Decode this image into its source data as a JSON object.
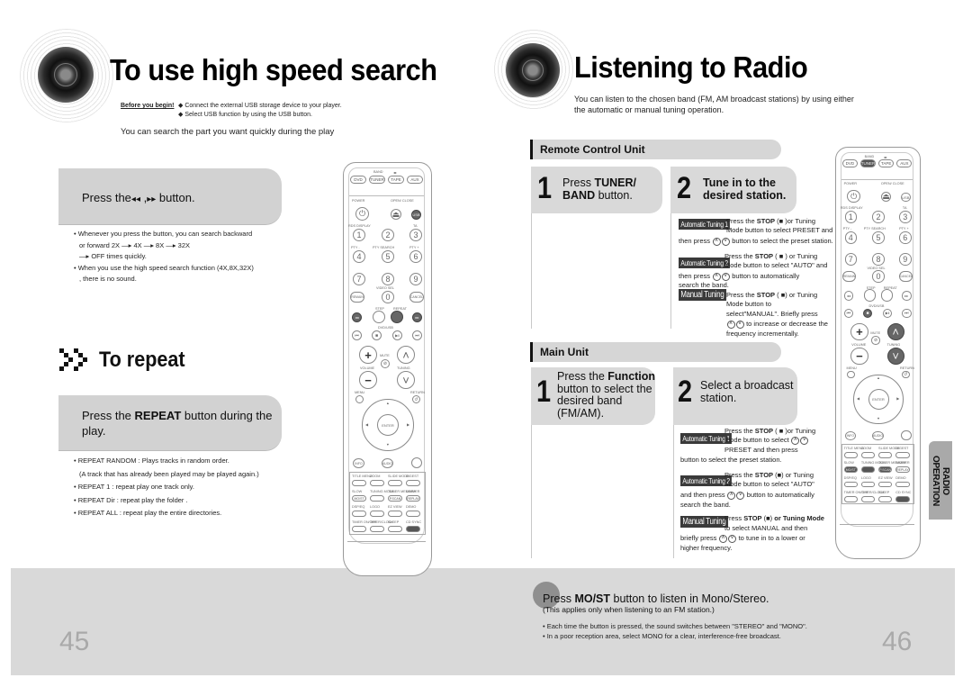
{
  "left_page": {
    "title": "To use high speed search",
    "before_begin_label": "Before you begin!",
    "before_begin_items": [
      "◆ Connect the external USB storage device to your player.",
      "◆ Select USB function by using the USB button."
    ],
    "intro": "You can search the part you want quickly during the play",
    "search_box": {
      "prefix": "Press the",
      "rewind_icon": "◂◂",
      "separator": " ,",
      "ff_icon": "▸▸",
      "suffix": " button."
    },
    "search_bullets": [
      "• Whenever you press  the button, you can search backward",
      "or forward 2X —▸ 4X —▸ 8X —▸ 32X",
      "—▸ OFF times quickly.",
      "• When you use the high speed search function (4X,8X,32X)",
      ", there is no sound."
    ],
    "repeat_title": "To repeat",
    "repeat_box": {
      "prefix": "Press the ",
      "bold": "REPEAT",
      "suffix": " button during the",
      "line2": "play."
    },
    "repeat_bullets": [
      "• REPEAT RANDOM : Plays tracks in random order.",
      "(A track that has already been played may be played again.)",
      "• REPEAT 1 : repeat play one track only.",
      "• REPEAT Dir : repeat play the folder .",
      "• REPEAT ALL : repeat play the entire directories."
    ],
    "page_number": "45"
  },
  "remote": {
    "band_label": "BAND",
    "sources": [
      "DVD",
      "TUNER",
      "TAPE",
      "AUX"
    ],
    "power_label": "POWER",
    "open_close_label": "OPEN/ CLOSE",
    "usb_label": "USB",
    "rds_label": "RDS DISPLAY",
    "ta_label": "TA",
    "pty_minus": "PTY -",
    "pty_search": "PTY SEARCH",
    "pty_plus": "PTY +",
    "digits": [
      "1",
      "2",
      "3",
      "4",
      "5",
      "6",
      "7",
      "8",
      "9",
      "0"
    ],
    "video_sel": "VIDEO SEL",
    "remain": "REMAIN",
    "cancel": "CANCEL",
    "step": "STEP",
    "repeat": "REPEAT",
    "dvd_usb": "DVD/USB",
    "mute": "MUTE",
    "volume": "VOLUME",
    "tuning": "TUNING",
    "menu": "MENU",
    "return": "RETURN",
    "enter": "ENTER",
    "info": "INFO",
    "audio": "AUDIO",
    "func_buttons": [
      [
        "TITLE MENU",
        "ZOOM",
        "SLIDE MODE",
        "DIGEST"
      ],
      [
        "SLOW",
        "TUNING MODE",
        "TUNER MEMORY",
        "DIMMER"
      ],
      [
        "DSP/EQ",
        "LOGO",
        "EZ VIEW",
        "DEMO"
      ],
      [
        "TIMER ON/OFF",
        "TIMER/CLOCK",
        "SLEEP",
        "CD SYNC"
      ]
    ],
    "func_sub": [
      "MO/ST",
      "",
      "P.SCAN",
      "REPLAY"
    ]
  },
  "right_page": {
    "title": "Listening to Radio",
    "intro_line1": "You can listen to the chosen band (FM, AM broadcast stations) by using either",
    "intro_line2": "the automatic or manual tuning operation.",
    "remote_section": {
      "header": "Remote Control Unit",
      "step1": {
        "num": "1",
        "line1_pre": "Press ",
        "line1_bold": "TUNER/",
        "line2_bold": "BAND",
        "line2_post": " button."
      },
      "step2": {
        "num": "2",
        "line1": "Tune in to the",
        "line2": "desired station."
      },
      "tunings": [
        {
          "tag": "Automatic Tuning 1",
          "lines": [
            "Press the STOP (■ )or Tuning",
            "Mode button to select PRESET and",
            "then press  ⌃⌄  button to select the preset station."
          ]
        },
        {
          "tag": "Automatic Tuning 2",
          "lines": [
            "Press the STOP ( ■ ) or Tuning",
            "Mode button to select \"AUTO\" and",
            "then press   ⌃⌄   button to automatically",
            "search the band."
          ]
        },
        {
          "tag": "Manual Tuning",
          "lines": [
            "Press the STOP ( ■) or Tuning",
            "Mode button to",
            "select\"MANUAL\". Briefly press",
            "⌃⌄ to increase or decrease the",
            "frequency incrementally."
          ]
        }
      ]
    },
    "main_section": {
      "header": "Main Unit",
      "step1": {
        "num": "1",
        "line1_pre": "Press the ",
        "line1_bold": "Function",
        "line2": "button to select the",
        "line3": "desired band",
        "line4": "(FM/AM)."
      },
      "step2": {
        "num": "2",
        "line1": "Select a broadcast",
        "line2": "station."
      },
      "tunings": [
        {
          "tag": "Automatic Tuning 1",
          "lines": [
            "Press the STOP ( ■ )or Tuning",
            "Mode button to select ⌃⌄",
            "PRESET and then press",
            "button to select the preset station."
          ]
        },
        {
          "tag": "Automatic Tuning 2",
          "lines": [
            "Press the STOP (■) or Tuning",
            "Mode button to select \"AUTO\"",
            "and then press  ⌃⌄   button to automatically",
            "search the band."
          ]
        },
        {
          "tag": "Manual Tuning",
          "lines": [
            "Press STOP (■) or Tuning Mode",
            "to select MANUAL and then",
            "briefly press  ⌃⌄   to tune in to a lower or",
            "higher frequency."
          ]
        }
      ]
    },
    "mono": {
      "title_pre": "Press ",
      "title_bold": "MO/ST",
      "title_post": " button to listen in Mono/Stereo.",
      "subtitle": "(This applies only when listening to an FM station.)",
      "bullets": [
        "• Each time the button is pressed, the sound switches between \"STEREO\" and \"MONO\".",
        "• In a poor reception area, select MONO for a clear, interference-free broadcast."
      ]
    },
    "side_tab": "RADIO OPERATION",
    "page_number": "46"
  }
}
